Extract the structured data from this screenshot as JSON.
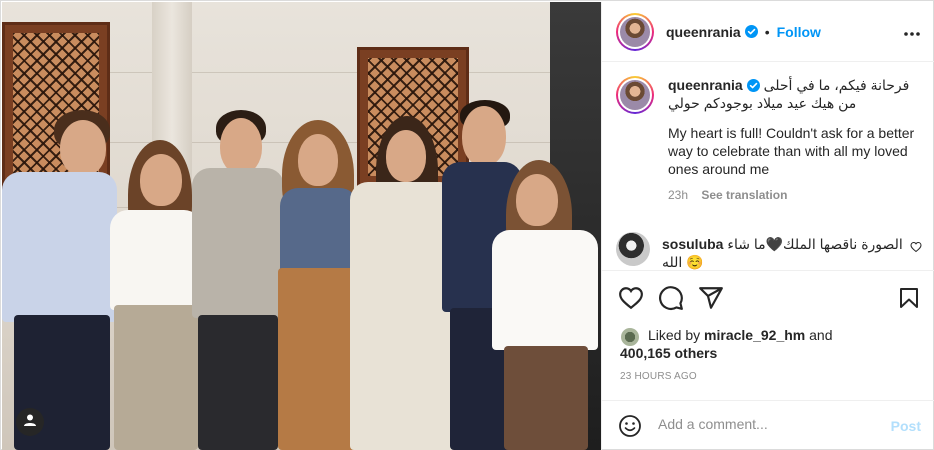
{
  "post": {
    "username": "queenrania",
    "follow_label": "Follow",
    "separator": "•",
    "caption_arabic": "فرحانة فيكم، ما في أحلى من هيك عيد ميلاد بوجودكم حولي",
    "caption_english": "My heart is full! Couldn't ask for a better way to celebrate than with all my loved ones around me",
    "caption_age": "23h",
    "see_translation": "See translation",
    "comment": {
      "username": "sosuluba",
      "text": "الصورة ناقصها الملك🖤ما شاء الله ☺️"
    },
    "likes": {
      "prefix": "Liked by",
      "user": "miracle_92_hm",
      "and": "and",
      "count": "400,165 others"
    },
    "timestamp": "23 HOURS AGO",
    "add_comment_placeholder": "Add a comment...",
    "post_label": "Post"
  },
  "icons": {
    "verified": "verified-badge-icon",
    "more": "more-options-icon",
    "heart": "heart-icon",
    "comment": "comment-icon",
    "share": "share-icon",
    "bookmark": "bookmark-icon",
    "emoji": "emoji-icon",
    "tag": "user-tag-icon"
  },
  "colors": {
    "accent": "#0095f6",
    "verified": "#0095f6",
    "post_disabled": "#b2dffc",
    "muted": "#8e8e8e"
  }
}
